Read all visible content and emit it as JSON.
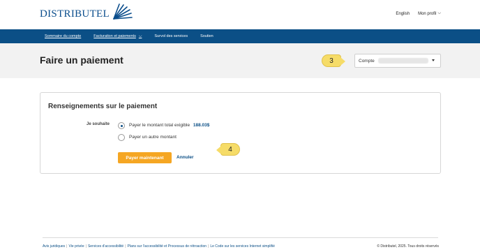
{
  "header": {
    "logo_text": "DISTRIBUTEL",
    "language_link": "English",
    "profile_link": "Mon profil"
  },
  "nav": {
    "items": [
      {
        "label": "Sommaire du compte"
      },
      {
        "label": "Facturation et paiements"
      },
      {
        "label": "Survol des services"
      },
      {
        "label": "Soutien"
      }
    ]
  },
  "page": {
    "title": "Faire un paiement",
    "account_label": "Compte"
  },
  "callouts": {
    "step3": "3",
    "step4": "4"
  },
  "payment": {
    "section_title": "Renseignements sur le paiement",
    "wish_label": "Je souhaite",
    "option_full": "Payer le montant total exigible",
    "option_full_amount": "188.03$",
    "option_other": "Payer un autre montant",
    "pay_button": "Payer maintenant",
    "cancel_link": "Annuler"
  },
  "footer": {
    "links": [
      "Avis juridiques",
      "Vie privée",
      "Services d'accessibilité",
      "Plans sur l'accessibilité et Processus de rétroaction",
      "Le Code sur les services Internet simplifié"
    ],
    "copyright": "© Distributel, 2025. Tous droits réservés"
  },
  "colors": {
    "nav_bg": "#0b4f86",
    "accent_button": "#f5a623",
    "callout": "#f6dc68"
  }
}
